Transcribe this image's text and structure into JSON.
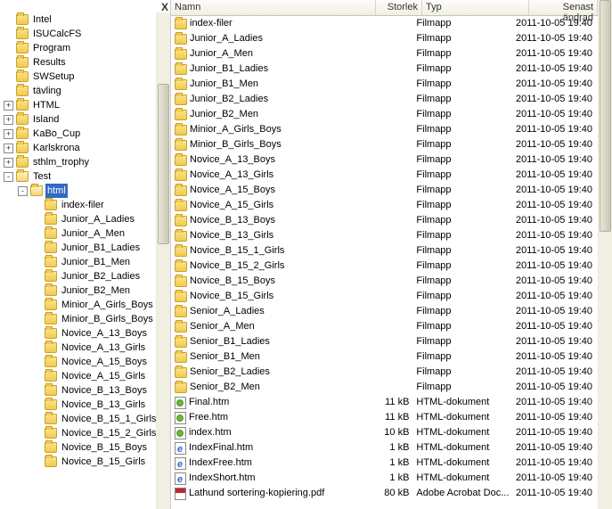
{
  "tree": {
    "close": "X",
    "items": [
      {
        "depth": 0,
        "exp": null,
        "icon": "folder",
        "label": "Intel",
        "sel": false
      },
      {
        "depth": 0,
        "exp": null,
        "icon": "folder",
        "label": "ISUCalcFS",
        "sel": false
      },
      {
        "depth": 0,
        "exp": null,
        "icon": "folder",
        "label": "Program",
        "sel": false
      },
      {
        "depth": 0,
        "exp": null,
        "icon": "folder",
        "label": "Results",
        "sel": false
      },
      {
        "depth": 0,
        "exp": null,
        "icon": "folder",
        "label": "SWSetup",
        "sel": false
      },
      {
        "depth": 0,
        "exp": null,
        "icon": "folder",
        "label": "tävling",
        "sel": false
      },
      {
        "depth": 0,
        "exp": "+",
        "icon": "folder",
        "label": "HTML",
        "sel": false
      },
      {
        "depth": 0,
        "exp": "+",
        "icon": "folder",
        "label": "Island",
        "sel": false
      },
      {
        "depth": 0,
        "exp": "+",
        "icon": "folder",
        "label": "KaBo_Cup",
        "sel": false
      },
      {
        "depth": 0,
        "exp": "+",
        "icon": "folder",
        "label": "Karlskrona",
        "sel": false
      },
      {
        "depth": 0,
        "exp": "+",
        "icon": "folder",
        "label": "sthlm_trophy",
        "sel": false
      },
      {
        "depth": 0,
        "exp": "-",
        "icon": "folder-open",
        "label": "Test",
        "sel": false
      },
      {
        "depth": 1,
        "exp": "-",
        "icon": "folder-open",
        "label": "html",
        "sel": true
      },
      {
        "depth": 2,
        "exp": null,
        "icon": "folder",
        "label": "index-filer",
        "sel": false
      },
      {
        "depth": 2,
        "exp": null,
        "icon": "folder",
        "label": "Junior_A_Ladies",
        "sel": false
      },
      {
        "depth": 2,
        "exp": null,
        "icon": "folder",
        "label": "Junior_A_Men",
        "sel": false
      },
      {
        "depth": 2,
        "exp": null,
        "icon": "folder",
        "label": "Junior_B1_Ladies",
        "sel": false
      },
      {
        "depth": 2,
        "exp": null,
        "icon": "folder",
        "label": "Junior_B1_Men",
        "sel": false
      },
      {
        "depth": 2,
        "exp": null,
        "icon": "folder",
        "label": "Junior_B2_Ladies",
        "sel": false
      },
      {
        "depth": 2,
        "exp": null,
        "icon": "folder",
        "label": "Junior_B2_Men",
        "sel": false
      },
      {
        "depth": 2,
        "exp": null,
        "icon": "folder",
        "label": "Minior_A_Girls_Boys",
        "sel": false
      },
      {
        "depth": 2,
        "exp": null,
        "icon": "folder",
        "label": "Minior_B_Girls_Boys",
        "sel": false
      },
      {
        "depth": 2,
        "exp": null,
        "icon": "folder",
        "label": "Novice_A_13_Boys",
        "sel": false
      },
      {
        "depth": 2,
        "exp": null,
        "icon": "folder",
        "label": "Novice_A_13_Girls",
        "sel": false
      },
      {
        "depth": 2,
        "exp": null,
        "icon": "folder",
        "label": "Novice_A_15_Boys",
        "sel": false
      },
      {
        "depth": 2,
        "exp": null,
        "icon": "folder",
        "label": "Novice_A_15_Girls",
        "sel": false
      },
      {
        "depth": 2,
        "exp": null,
        "icon": "folder",
        "label": "Novice_B_13_Boys",
        "sel": false
      },
      {
        "depth": 2,
        "exp": null,
        "icon": "folder",
        "label": "Novice_B_13_Girls",
        "sel": false
      },
      {
        "depth": 2,
        "exp": null,
        "icon": "folder",
        "label": "Novice_B_15_1_Girls",
        "sel": false
      },
      {
        "depth": 2,
        "exp": null,
        "icon": "folder",
        "label": "Novice_B_15_2_Girls",
        "sel": false
      },
      {
        "depth": 2,
        "exp": null,
        "icon": "folder",
        "label": "Novice_B_15_Boys",
        "sel": false
      },
      {
        "depth": 2,
        "exp": null,
        "icon": "folder",
        "label": "Novice_B_15_Girls",
        "sel": false
      }
    ]
  },
  "list": {
    "headers": {
      "name": "Namn",
      "size": "Storlek",
      "type": "Typ",
      "date": "Senast ändrad"
    },
    "rows": [
      {
        "icon": "folder",
        "name": "index-filer",
        "size": "",
        "type": "Filmapp",
        "date": "2011-10-05 19:40"
      },
      {
        "icon": "folder",
        "name": "Junior_A_Ladies",
        "size": "",
        "type": "Filmapp",
        "date": "2011-10-05 19:40"
      },
      {
        "icon": "folder",
        "name": "Junior_A_Men",
        "size": "",
        "type": "Filmapp",
        "date": "2011-10-05 19:40"
      },
      {
        "icon": "folder",
        "name": "Junior_B1_Ladies",
        "size": "",
        "type": "Filmapp",
        "date": "2011-10-05 19:40"
      },
      {
        "icon": "folder",
        "name": "Junior_B1_Men",
        "size": "",
        "type": "Filmapp",
        "date": "2011-10-05 19:40"
      },
      {
        "icon": "folder",
        "name": "Junior_B2_Ladies",
        "size": "",
        "type": "Filmapp",
        "date": "2011-10-05 19:40"
      },
      {
        "icon": "folder",
        "name": "Junior_B2_Men",
        "size": "",
        "type": "Filmapp",
        "date": "2011-10-05 19:40"
      },
      {
        "icon": "folder",
        "name": "Minior_A_Girls_Boys",
        "size": "",
        "type": "Filmapp",
        "date": "2011-10-05 19:40"
      },
      {
        "icon": "folder",
        "name": "Minior_B_Girls_Boys",
        "size": "",
        "type": "Filmapp",
        "date": "2011-10-05 19:40"
      },
      {
        "icon": "folder",
        "name": "Novice_A_13_Boys",
        "size": "",
        "type": "Filmapp",
        "date": "2011-10-05 19:40"
      },
      {
        "icon": "folder",
        "name": "Novice_A_13_Girls",
        "size": "",
        "type": "Filmapp",
        "date": "2011-10-05 19:40"
      },
      {
        "icon": "folder",
        "name": "Novice_A_15_Boys",
        "size": "",
        "type": "Filmapp",
        "date": "2011-10-05 19:40"
      },
      {
        "icon": "folder",
        "name": "Novice_A_15_Girls",
        "size": "",
        "type": "Filmapp",
        "date": "2011-10-05 19:40"
      },
      {
        "icon": "folder",
        "name": "Novice_B_13_Boys",
        "size": "",
        "type": "Filmapp",
        "date": "2011-10-05 19:40"
      },
      {
        "icon": "folder",
        "name": "Novice_B_13_Girls",
        "size": "",
        "type": "Filmapp",
        "date": "2011-10-05 19:40"
      },
      {
        "icon": "folder",
        "name": "Novice_B_15_1_Girls",
        "size": "",
        "type": "Filmapp",
        "date": "2011-10-05 19:40"
      },
      {
        "icon": "folder",
        "name": "Novice_B_15_2_Girls",
        "size": "",
        "type": "Filmapp",
        "date": "2011-10-05 19:40"
      },
      {
        "icon": "folder",
        "name": "Novice_B_15_Boys",
        "size": "",
        "type": "Filmapp",
        "date": "2011-10-05 19:40"
      },
      {
        "icon": "folder",
        "name": "Novice_B_15_Girls",
        "size": "",
        "type": "Filmapp",
        "date": "2011-10-05 19:40"
      },
      {
        "icon": "folder",
        "name": "Senior_A_Ladies",
        "size": "",
        "type": "Filmapp",
        "date": "2011-10-05 19:40"
      },
      {
        "icon": "folder",
        "name": "Senior_A_Men",
        "size": "",
        "type": "Filmapp",
        "date": "2011-10-05 19:40"
      },
      {
        "icon": "folder",
        "name": "Senior_B1_Ladies",
        "size": "",
        "type": "Filmapp",
        "date": "2011-10-05 19:40"
      },
      {
        "icon": "folder",
        "name": "Senior_B1_Men",
        "size": "",
        "type": "Filmapp",
        "date": "2011-10-05 19:40"
      },
      {
        "icon": "folder",
        "name": "Senior_B2_Ladies",
        "size": "",
        "type": "Filmapp",
        "date": "2011-10-05 19:40"
      },
      {
        "icon": "folder",
        "name": "Senior_B2_Men",
        "size": "",
        "type": "Filmapp",
        "date": "2011-10-05 19:40"
      },
      {
        "icon": "htm",
        "name": "Final.htm",
        "size": "11 kB",
        "type": "HTML-dokument",
        "date": "2011-10-05 19:40"
      },
      {
        "icon": "htm",
        "name": "Free.htm",
        "size": "11 kB",
        "type": "HTML-dokument",
        "date": "2011-10-05 19:40"
      },
      {
        "icon": "htm",
        "name": "index.htm",
        "size": "10 kB",
        "type": "HTML-dokument",
        "date": "2011-10-05 19:40"
      },
      {
        "icon": "ie",
        "name": "IndexFinal.htm",
        "size": "1 kB",
        "type": "HTML-dokument",
        "date": "2011-10-05 19:40"
      },
      {
        "icon": "ie",
        "name": "IndexFree.htm",
        "size": "1 kB",
        "type": "HTML-dokument",
        "date": "2011-10-05 19:40"
      },
      {
        "icon": "ie",
        "name": "IndexShort.htm",
        "size": "1 kB",
        "type": "HTML-dokument",
        "date": "2011-10-05 19:40"
      },
      {
        "icon": "pdf",
        "name": "Lathund sortering-kopiering.pdf",
        "size": "80 kB",
        "type": "Adobe Acrobat Doc...",
        "date": "2011-10-05 19:40"
      }
    ]
  }
}
